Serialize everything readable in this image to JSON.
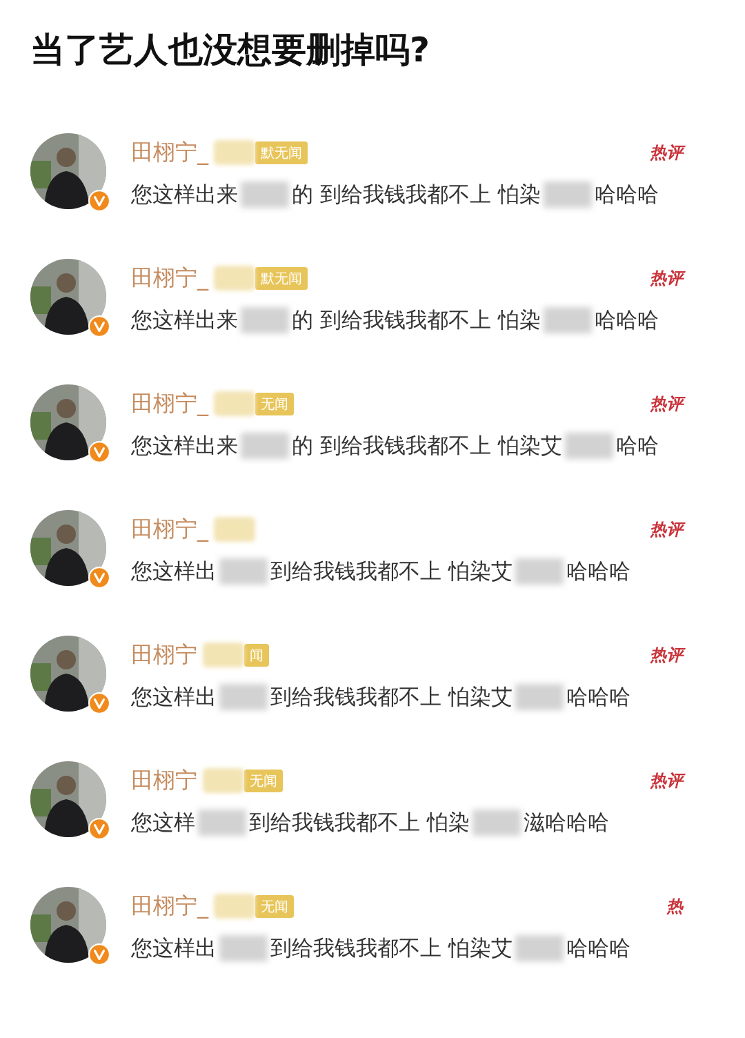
{
  "title": "当了艺人也没想要删掉吗?",
  "comments": [
    {
      "name": "田栩宁_",
      "badge": "默无闻",
      "hot_label": "热评",
      "parts": [
        {
          "kind": "text",
          "text": "您这样出来"
        },
        {
          "kind": "blur"
        },
        {
          "kind": "text",
          "text": "的 到给我钱我都不上 怕染"
        },
        {
          "kind": "blur"
        },
        {
          "kind": "text",
          "text": "哈哈哈"
        }
      ]
    },
    {
      "name": "田栩宁_",
      "badge": "默无闻",
      "hot_label": "热评",
      "parts": [
        {
          "kind": "text",
          "text": "您这样出来"
        },
        {
          "kind": "blur"
        },
        {
          "kind": "text",
          "text": "的 到给我钱我都不上 怕染"
        },
        {
          "kind": "blur"
        },
        {
          "kind": "text",
          "text": "哈哈哈"
        }
      ]
    },
    {
      "name": "田栩宁_",
      "badge": "无闻",
      "hot_label": "热评",
      "parts": [
        {
          "kind": "text",
          "text": "您这样出来"
        },
        {
          "kind": "blur"
        },
        {
          "kind": "text",
          "text": "的 到给我钱我都不上 怕染艾"
        },
        {
          "kind": "blur"
        },
        {
          "kind": "text",
          "text": "哈哈"
        }
      ]
    },
    {
      "name": "田栩宁_",
      "hot_label": "热评",
      "parts": [
        {
          "kind": "text",
          "text": "您这样出"
        },
        {
          "kind": "blur"
        },
        {
          "kind": "text",
          "text": "到给我钱我都不上 怕染艾"
        },
        {
          "kind": "blur"
        },
        {
          "kind": "text",
          "text": "哈哈哈"
        }
      ]
    },
    {
      "name": "田栩宁",
      "badge": "闻",
      "hot_label": "热评",
      "parts": [
        {
          "kind": "text",
          "text": "您这样出"
        },
        {
          "kind": "blur"
        },
        {
          "kind": "text",
          "text": "到给我钱我都不上 怕染艾"
        },
        {
          "kind": "blur"
        },
        {
          "kind": "text",
          "text": "哈哈哈"
        }
      ]
    },
    {
      "name": "田栩宁",
      "badge": "无闻",
      "hot_label": "热评",
      "parts": [
        {
          "kind": "text",
          "text": "您这样"
        },
        {
          "kind": "blur"
        },
        {
          "kind": "text",
          "text": "到给我钱我都不上 怕染"
        },
        {
          "kind": "blur"
        },
        {
          "kind": "text",
          "text": "滋哈哈哈"
        }
      ]
    },
    {
      "name": "田栩宁_",
      "badge": "无闻",
      "hot_label": "热",
      "parts": [
        {
          "kind": "text",
          "text": "您这样出"
        },
        {
          "kind": "blur"
        },
        {
          "kind": "text",
          "text": "到给我钱我都不上 怕染艾"
        },
        {
          "kind": "blur"
        },
        {
          "kind": "text",
          "text": "哈哈哈"
        }
      ]
    }
  ]
}
